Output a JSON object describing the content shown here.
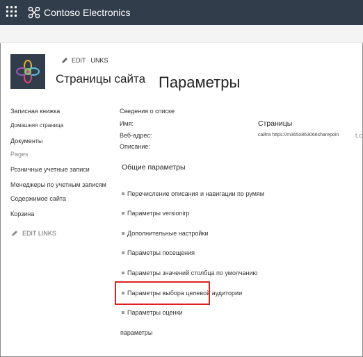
{
  "suite_bar": {
    "brand_title": "Contoso Electronics",
    "waffle_icon": "app-launcher-icon",
    "brand_icon": "network-logo-icon",
    "background": "#323d4c"
  },
  "header": {
    "edit_label": "EDIT",
    "edit_links_label": "UNKS",
    "site_title": "Страницы сайта",
    "page_title": "Параметры"
  },
  "nav": {
    "items": [
      "Записная книжка",
      "Домашняя страница",
      "Документы",
      "Pages",
      "Розничные учетные записи",
      "Менеджеры по учетным записям",
      "Содержимое сайта",
      "Корзина"
    ],
    "edit_links_label": "EDIT LINKS"
  },
  "list_info": {
    "heading": "Сведения о списке",
    "name_label": "Имя:",
    "name_value": "Страницы",
    "web_label": "Веб-адрес:",
    "web_value": "сайта  https://m365x863066sharepoin",
    "web_tail": "t.co",
    "description_label": "Описание:"
  },
  "general": {
    "heading": "Общие параметры",
    "items": [
      "Перечисление описания и навигации по румям",
      "Параметры versionirp",
      "Дополнительные настройки",
      "Параметры посещения",
      "Параметры значений столбца по умолчанию",
      "Параметры выбора целевой аудитории",
      "Параметры оценки"
    ],
    "footer": "параметры"
  },
  "accent_colors": {
    "highlight": "#e02020",
    "suite_bar": "#323d4c"
  }
}
